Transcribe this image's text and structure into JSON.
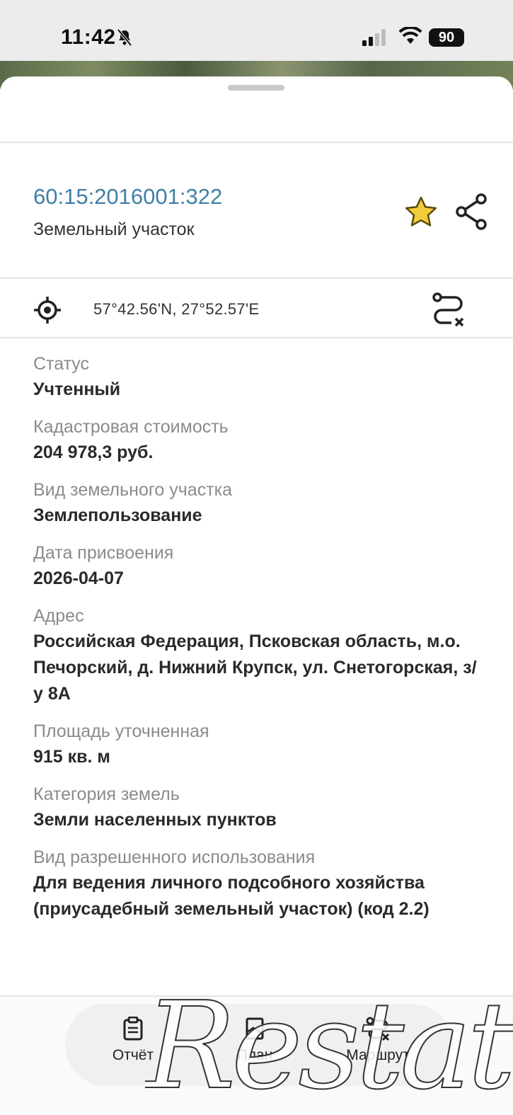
{
  "status_bar": {
    "time": "11:42",
    "battery": "90"
  },
  "header": {
    "cadastral_number": "60:15:2016001:322",
    "object_type": "Земельный участок"
  },
  "location": {
    "coordinates": "57°42.56'N, 27°52.57'E"
  },
  "fields": [
    {
      "label": "Статус",
      "value": "Учтенный"
    },
    {
      "label": "Кадастровая стоимость",
      "value": "204 978,3 руб."
    },
    {
      "label": "Вид земельного участка",
      "value": "Землепользование"
    },
    {
      "label": "Дата присвоения",
      "value": "2026-04-07"
    },
    {
      "label": "Адрес",
      "value": "Российская Федерация, Псковская область, м.о. Печорский, д. Нижний Крупск, ул. Снетогорская, з/у 8А"
    },
    {
      "label": "Площадь уточненная",
      "value": "915 кв. м"
    },
    {
      "label": "Категория земель",
      "value": "Земли населенных пунктов"
    },
    {
      "label": "Вид разрешенного использования",
      "value": "Для ведения личного подсобного хозяйства (приусадебный земельный участок) (код 2.2)"
    }
  ],
  "bottom_tabs": [
    {
      "label": "Отчёт",
      "icon": "clipboard-icon"
    },
    {
      "label": "План",
      "icon": "plan-icon"
    },
    {
      "label": "Маршрут",
      "icon": "route-icon"
    }
  ],
  "watermark": "Restate",
  "colors": {
    "accent_link": "#3f7fa6",
    "star": "#f2cc3a"
  }
}
